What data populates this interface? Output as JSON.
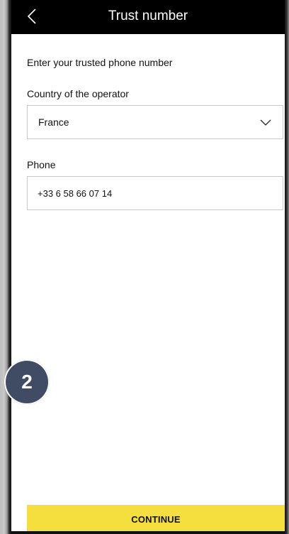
{
  "header": {
    "title": "Trust number",
    "back_icon": "chevron-left-icon"
  },
  "form": {
    "instruction": "Enter your trusted phone number",
    "country_label": "Country of the operator",
    "country_value": "France",
    "country_icon": "chevron-down-icon",
    "phone_label": "Phone",
    "phone_value": "+33 6 58 66 07 14"
  },
  "overlay": {
    "step_number": "2",
    "step_color": "#3f4c63"
  },
  "footer": {
    "continue_label": "CONTINUE",
    "button_color": "#f4df3e"
  },
  "colors": {
    "header_bg": "#000000",
    "field_border": "#c8c8c8"
  }
}
